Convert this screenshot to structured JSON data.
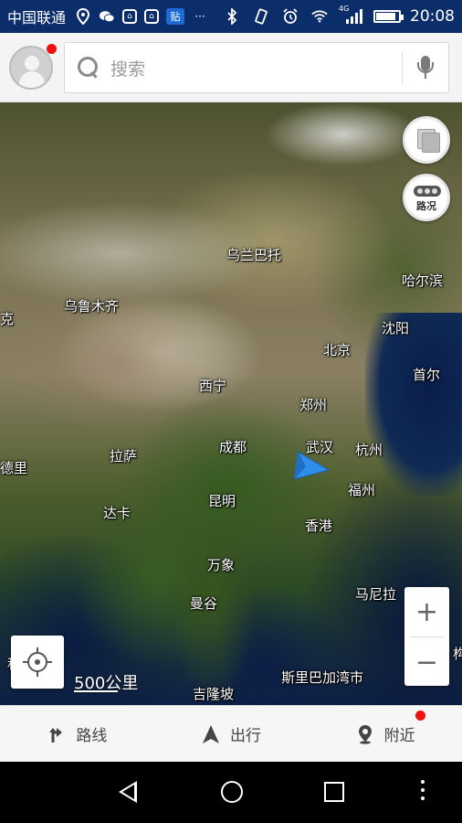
{
  "status_bar": {
    "carrier": "中国联通",
    "network": "4G",
    "time": "20:08",
    "left_icons": [
      "location-icon",
      "wechat-icon",
      "app-icon",
      "app-icon",
      "tieba-icon",
      "more-notifications-icon"
    ],
    "right_icons": [
      "bluetooth-icon",
      "vibrate-icon",
      "alarm-icon",
      "wifi-icon",
      "signal-icon",
      "battery-icon"
    ],
    "tieba_label": "贴",
    "more_label": "···",
    "battery_level": 0.82
  },
  "search": {
    "placeholder": "搜索"
  },
  "map": {
    "cities": [
      {
        "name": "乌兰巴托"
      },
      {
        "name": "哈尔滨"
      },
      {
        "name": "乌鲁木齐"
      },
      {
        "name": "沈阳"
      },
      {
        "name": "克"
      },
      {
        "name": "北京"
      },
      {
        "name": "首尔"
      },
      {
        "name": "西宁"
      },
      {
        "name": "郑州"
      },
      {
        "name": "成都"
      },
      {
        "name": "武汉"
      },
      {
        "name": "杭州"
      },
      {
        "name": "拉萨"
      },
      {
        "name": "德里"
      },
      {
        "name": "福州"
      },
      {
        "name": "昆明"
      },
      {
        "name": "达卡"
      },
      {
        "name": "香港"
      },
      {
        "name": "万象"
      },
      {
        "name": "曼谷"
      },
      {
        "name": "马尼拉"
      },
      {
        "name": "科伦"
      },
      {
        "name": "吉隆坡"
      },
      {
        "name": "斯里巴加湾市"
      },
      {
        "name": "构"
      }
    ],
    "traffic_label": "路况",
    "zoom_in": "+",
    "zoom_out": "−",
    "scale": "500公里"
  },
  "bottom_nav": {
    "route": "路线",
    "go": "出行",
    "nearby": "附近"
  },
  "colors": {
    "status_bar_bg": "#0b2d6a",
    "badge_red": "#ee1111",
    "nav_arrow": "#2f8fe8"
  }
}
